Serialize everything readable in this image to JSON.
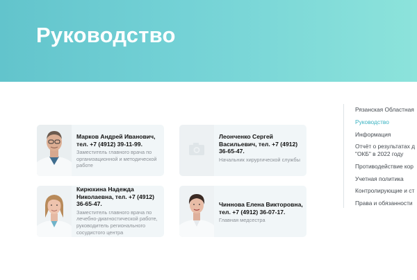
{
  "header": {
    "title": "Руководство"
  },
  "staff": [
    {
      "name": "Марков Андрей Иванович, тел. +7 (4912) 39-11-99.",
      "role": "Заместитель главного врача по организационной и методической работе",
      "photo": "doctor-photo"
    },
    {
      "name": "Леонченко Сергей Васильевич, тел. +7 (4912) 36-65-47.",
      "role": "Начальник хирургической службы",
      "photo": "camera-placeholder-icon"
    },
    {
      "name": "Кирюхина Надежда Николаевна, тел. +7 (4912) 36-65-47.",
      "role": "Заместитель главного врача по лечебно-диагностической работе, руководитель регионального сосудистого центра",
      "photo": "doctor-photo"
    },
    {
      "name": "Чиннова Елена Викторовна, тел. +7 (4912) 36-07-17.",
      "role": "Главная медсестра",
      "photo": "nurse-photo"
    }
  ],
  "sidebar": {
    "items": [
      {
        "label": "Рязанская Областная"
      },
      {
        "label": "Руководство",
        "active": true
      },
      {
        "label": "Информация"
      },
      {
        "label": "Отчёт о результатах д"
      },
      {
        "label": "\"ОКБ\" в 2022 году"
      },
      {
        "label": "Противодействие кор"
      },
      {
        "label": "Учетная политика"
      },
      {
        "label": "Контролирующие и ст"
      },
      {
        "label": "Права и обязанности"
      }
    ]
  },
  "colors": {
    "hero_start": "#62c4cc",
    "hero_end": "#8ce3db",
    "active_link": "#3ab3c2",
    "card_bg": "#f1f6f8"
  }
}
